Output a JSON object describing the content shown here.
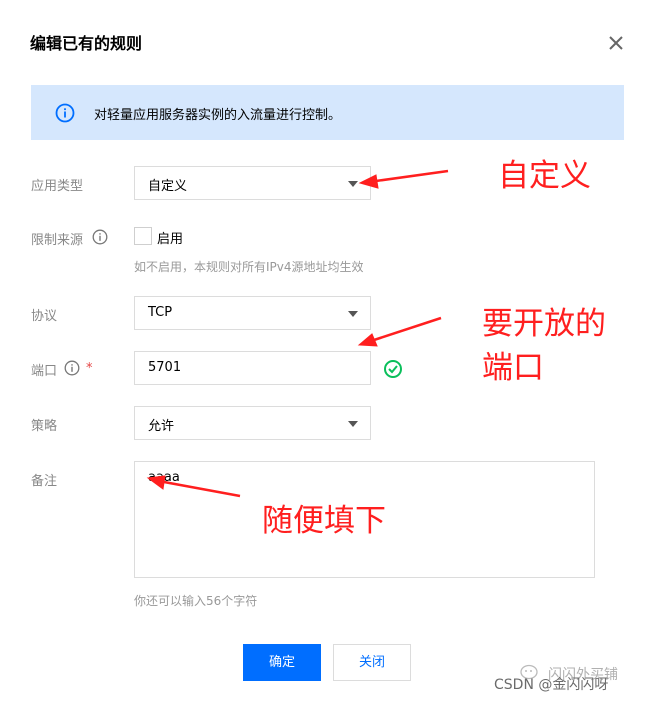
{
  "dialog": {
    "title": "编辑已有的规则",
    "info": "对轻量应用服务器实例的入流量进行控制。"
  },
  "form": {
    "app_type": {
      "label": "应用类型",
      "value": "自定义"
    },
    "source_limit": {
      "label": "限制来源",
      "checkbox_label": "启用",
      "checked": false,
      "hint": "如不启用，本规则对所有IPv4源地址均生效"
    },
    "protocol": {
      "label": "协议",
      "value": "TCP"
    },
    "port": {
      "label": "端口",
      "required_mark": "*",
      "value": "5701"
    },
    "policy": {
      "label": "策略",
      "value": "允许"
    },
    "remark": {
      "label": "备注",
      "value": "aaaa",
      "hint": "你还可以输入56个字符"
    }
  },
  "buttons": {
    "confirm": "确定",
    "close": "关闭"
  },
  "annotations": {
    "custom": "自定义",
    "port_line1": "要开放的",
    "port_line2": "端口",
    "remark": "随便填下"
  },
  "watermark": {
    "csdn": "CSDN @金闪闪呀",
    "wechat": "闪闪外买铺"
  },
  "colors": {
    "primary": "#006eff",
    "info_bg": "#d5e7fd",
    "annotation": "#ff1f1f",
    "success": "#0abf5b",
    "required": "#e54545"
  }
}
